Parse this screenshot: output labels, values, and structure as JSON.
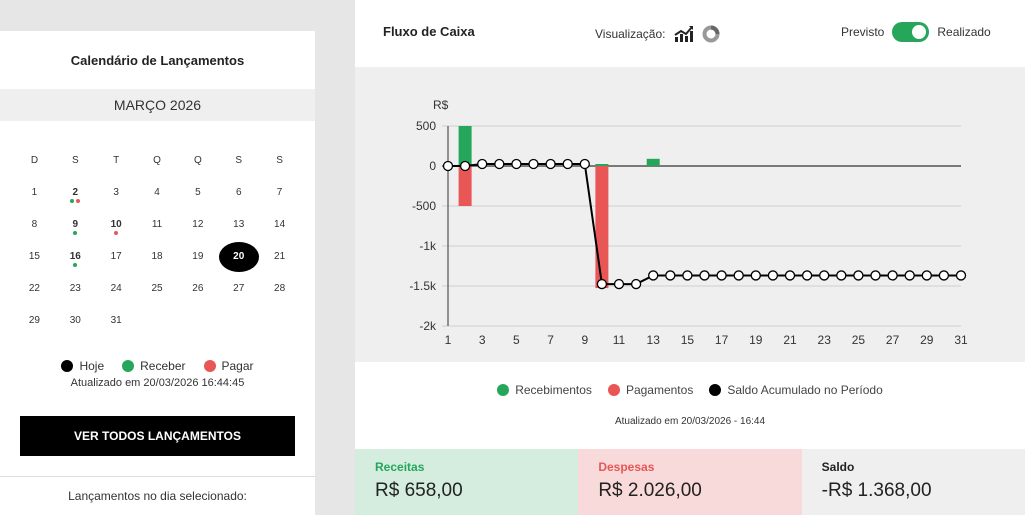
{
  "calendar": {
    "title": "Calendário de Lançamentos",
    "month": "MARÇO 2026",
    "weekdays": [
      "D",
      "S",
      "T",
      "Q",
      "Q",
      "S",
      "S"
    ],
    "weeks": [
      [
        {
          "d": "1"
        },
        {
          "d": "2",
          "bold": true,
          "dots": [
            "#26a65b",
            "#e85656"
          ]
        },
        {
          "d": "3"
        },
        {
          "d": "4"
        },
        {
          "d": "5"
        },
        {
          "d": "6"
        },
        {
          "d": "7"
        }
      ],
      [
        {
          "d": "8"
        },
        {
          "d": "9",
          "bold": true,
          "dots": [
            "#26a65b"
          ]
        },
        {
          "d": "10",
          "bold": true,
          "dots": [
            "#e85656"
          ]
        },
        {
          "d": "11"
        },
        {
          "d": "12"
        },
        {
          "d": "13"
        },
        {
          "d": "14"
        }
      ],
      [
        {
          "d": "15"
        },
        {
          "d": "16",
          "bold": true,
          "dots": [
            "#26a65b"
          ]
        },
        {
          "d": "17"
        },
        {
          "d": "18"
        },
        {
          "d": "19"
        },
        {
          "d": "20",
          "today": true
        },
        {
          "d": "21"
        }
      ],
      [
        {
          "d": "22"
        },
        {
          "d": "23"
        },
        {
          "d": "24"
        },
        {
          "d": "25"
        },
        {
          "d": "26"
        },
        {
          "d": "27"
        },
        {
          "d": "28"
        }
      ],
      [
        {
          "d": "29"
        },
        {
          "d": "30"
        },
        {
          "d": "31"
        }
      ]
    ],
    "legend": {
      "today": "Hoje",
      "receive": "Receber",
      "pay": "Pagar"
    },
    "updated": "Atualizado em 20/03/2026 16:44:45",
    "view_all_label": "VER TODOS LANÇAMENTOS",
    "selected_day_label": "Lançamentos no dia selecionado:"
  },
  "cashflow": {
    "title": "Fluxo de Caixa",
    "visualization_label": "Visualização:",
    "toggle_left": "Previsto",
    "toggle_right": "Realizado",
    "toggle_on": true,
    "legend": {
      "receipts": "Recebimentos",
      "payments": "Pagamentos",
      "balance": "Saldo Acumulado no Período"
    },
    "updated": "Atualizado em 20/03/2026 - 16:44"
  },
  "summary": {
    "receitas_label": "Receitas",
    "receitas_value": "R$ 658,00",
    "despesas_label": "Despesas",
    "despesas_value": "R$ 2.026,00",
    "saldo_label": "Saldo",
    "saldo_value": "-R$ 1.368,00"
  },
  "colors": {
    "green": "#26a65b",
    "red": "#e85656",
    "black": "#000000",
    "receitas_bg": "#d4eddf",
    "receitas_fg": "#26a65b",
    "despesas_bg": "#f9dadb",
    "despesas_fg": "#e85656",
    "saldo_bg": "#efefef",
    "saldo_fg": "#222222"
  },
  "chart_data": {
    "type": "bar",
    "ylabel": "R$",
    "y_ticks": [
      "500",
      "0",
      "-500",
      "-1k",
      "-1.5k",
      "-2k"
    ],
    "y_tick_values": [
      500,
      0,
      -500,
      -1000,
      -1500,
      -2000
    ],
    "x_ticks": [
      "1",
      "3",
      "5",
      "7",
      "9",
      "11",
      "13",
      "15",
      "17",
      "19",
      "21",
      "23",
      "25",
      "27",
      "29",
      "31"
    ],
    "xlim": [
      1,
      31
    ],
    "ylim": [
      -2000,
      500
    ],
    "series": [
      {
        "name": "Recebimentos",
        "kind": "bar",
        "points": [
          {
            "x": 2,
            "y": 500
          },
          {
            "x": 10,
            "y": 25
          },
          {
            "x": 13,
            "y": 90
          }
        ]
      },
      {
        "name": "Pagamentos",
        "kind": "bar",
        "points": [
          {
            "x": 2,
            "y": -500
          },
          {
            "x": 10,
            "y": -1526
          }
        ]
      },
      {
        "name": "Saldo Acumulado no Período",
        "kind": "line",
        "x": [
          1,
          2,
          3,
          4,
          5,
          6,
          7,
          8,
          9,
          10,
          11,
          12,
          13,
          14,
          15,
          16,
          17,
          18,
          19,
          20,
          21,
          22,
          23,
          24,
          25,
          26,
          27,
          28,
          29,
          30,
          31
        ],
        "y": [
          0,
          0,
          25,
          25,
          25,
          25,
          25,
          25,
          25,
          -1476,
          -1476,
          -1476,
          -1368,
          -1368,
          -1368,
          -1368,
          -1368,
          -1368,
          -1368,
          -1368,
          -1368,
          -1368,
          -1368,
          -1368,
          -1368,
          -1368,
          -1368,
          -1368,
          -1368,
          -1368,
          -1368
        ]
      }
    ]
  }
}
